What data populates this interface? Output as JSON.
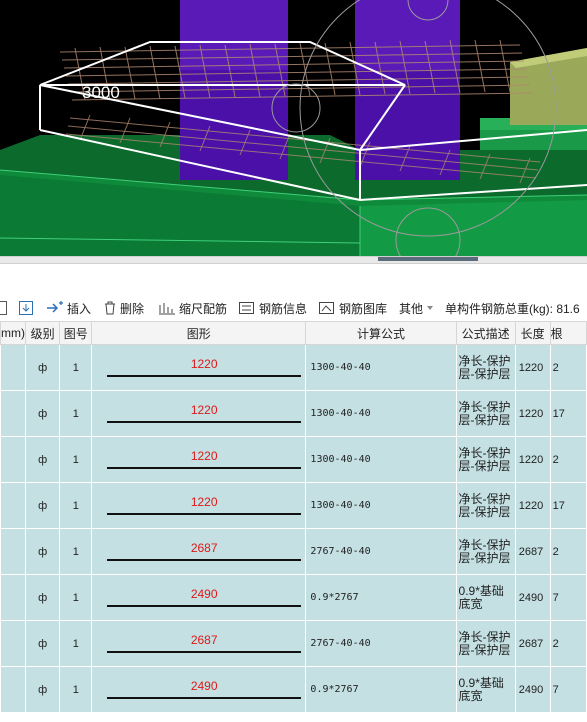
{
  "viewport": {
    "dimension_label": "3000"
  },
  "toolbar": {
    "insert_label": "插入",
    "delete_label": "删除",
    "scale_label": "缩尺配筋",
    "rebar_info_label": "钢筋信息",
    "rebar_library_label": "钢筋图库",
    "other_label": "其他",
    "total_weight_label": "单构件钢筋总重(kg): 81.6"
  },
  "table": {
    "headers": {
      "dia": "mm)",
      "grade": "级别",
      "fig_no": "图号",
      "shape": "图形",
      "formula": "计算公式",
      "desc": "公式描述",
      "length": "长度",
      "count": "根"
    },
    "rows": [
      {
        "grade": "ф",
        "fig_no": "1",
        "shape_value": "1220",
        "formula": "1300-40-40",
        "desc": "净长-保护层-保护层",
        "length": "1220",
        "count": "2"
      },
      {
        "grade": "ф",
        "fig_no": "1",
        "shape_value": "1220",
        "formula": "1300-40-40",
        "desc": "净长-保护层-保护层",
        "length": "1220",
        "count": "17"
      },
      {
        "grade": "ф",
        "fig_no": "1",
        "shape_value": "1220",
        "formula": "1300-40-40",
        "desc": "净长-保护层-保护层",
        "length": "1220",
        "count": "2"
      },
      {
        "grade": "ф",
        "fig_no": "1",
        "shape_value": "1220",
        "formula": "1300-40-40",
        "desc": "净长-保护层-保护层",
        "length": "1220",
        "count": "17"
      },
      {
        "grade": "ф",
        "fig_no": "1",
        "shape_value": "2687",
        "formula": "2767-40-40",
        "desc": "净长-保护层-保护层",
        "length": "2687",
        "count": "2"
      },
      {
        "grade": "ф",
        "fig_no": "1",
        "shape_value": "2490",
        "formula": "0.9*2767",
        "desc": "0.9*基础底宽",
        "length": "2490",
        "count": "7"
      },
      {
        "grade": "ф",
        "fig_no": "1",
        "shape_value": "2687",
        "formula": "2767-40-40",
        "desc": "净长-保护层-保护层",
        "length": "2687",
        "count": "2"
      },
      {
        "grade": "ф",
        "fig_no": "1",
        "shape_value": "2490",
        "formula": "0.9*2767",
        "desc": "0.9*基础底宽",
        "length": "2490",
        "count": "7"
      }
    ]
  },
  "colors": {
    "row_bg": "#c4e0e3",
    "shape_value": "#e01818",
    "column_purple": "#4a10a8"
  }
}
